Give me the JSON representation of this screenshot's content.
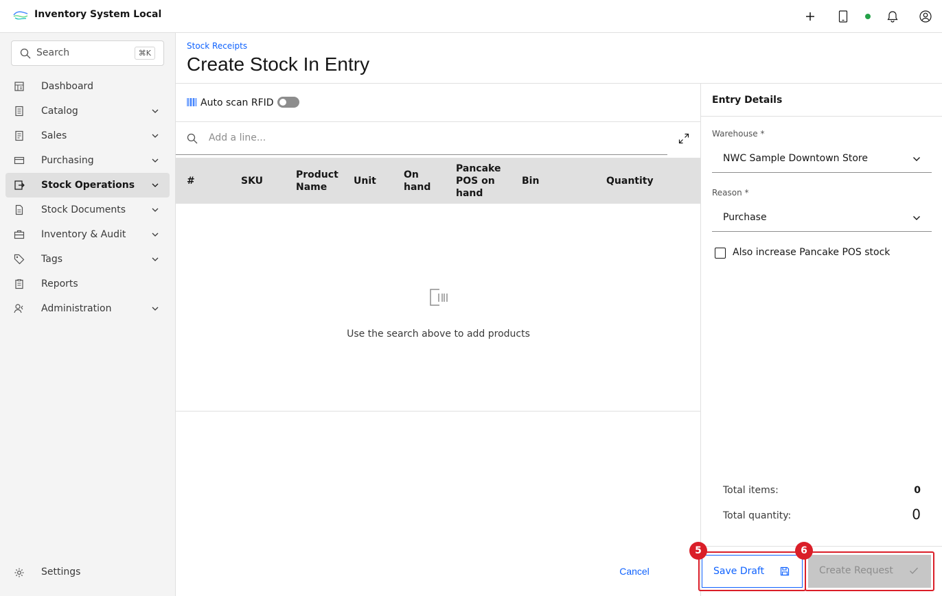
{
  "app": {
    "title": "Inventory System Local",
    "logo_icon": "brand-logo"
  },
  "header": {
    "icons": [
      "add-icon",
      "tablet-icon",
      "status-online-dot",
      "notification-icon",
      "user-avatar-icon"
    ],
    "status_color": "#24a148"
  },
  "sidebar": {
    "search": {
      "placeholder": "Search",
      "shortcut": "⌘K"
    },
    "items": [
      {
        "label": "Dashboard",
        "icon": "dashboard-icon",
        "expandable": false,
        "active": false
      },
      {
        "label": "Catalog",
        "icon": "catalog-icon",
        "expandable": true,
        "active": false
      },
      {
        "label": "Sales",
        "icon": "sales-icon",
        "expandable": true,
        "active": false
      },
      {
        "label": "Purchasing",
        "icon": "credit-card-icon",
        "expandable": true,
        "active": false
      },
      {
        "label": "Stock Operations",
        "icon": "stock-ops-icon",
        "expandable": true,
        "active": true
      },
      {
        "label": "Stock Documents",
        "icon": "document-icon",
        "expandable": true,
        "active": false
      },
      {
        "label": "Inventory & Audit",
        "icon": "inventory-icon",
        "expandable": true,
        "active": false
      },
      {
        "label": "Tags",
        "icon": "tag-icon",
        "expandable": true,
        "active": false
      },
      {
        "label": "Reports",
        "icon": "report-icon",
        "expandable": false,
        "active": false
      },
      {
        "label": "Administration",
        "icon": "user-admin-icon",
        "expandable": true,
        "active": false
      }
    ],
    "settings_label": "Settings"
  },
  "page": {
    "breadcrumb": "Stock Receipts",
    "title": "Create Stock In Entry"
  },
  "lines": {
    "rfid_label": "Auto scan RFID",
    "rfid_enabled": false,
    "add_line_placeholder": "Add a line...",
    "columns": {
      "num": "#",
      "sku": "SKU",
      "product_name_1": "Product",
      "product_name_2": "Name",
      "unit": "Unit",
      "on_hand_1": "On",
      "on_hand_2": "hand",
      "pos_1": "Pancake",
      "pos_2": "POS on",
      "pos_3": "hand",
      "bin": "Bin",
      "quantity": "Quantity"
    },
    "rows": [],
    "empty_text": "Use the search above to add products"
  },
  "entry_details": {
    "title": "Entry Details",
    "warehouse_label": "Warehouse *",
    "warehouse_value": "NWC Sample Downtown Store",
    "reason_label": "Reason *",
    "reason_value": "Purchase",
    "pos_checkbox_label": "Also increase Pancake POS stock",
    "pos_checkbox_checked": false,
    "total_items_label": "Total items:",
    "total_items_value": "0",
    "total_quantity_label": "Total quantity:",
    "total_quantity_value": "0"
  },
  "actions": {
    "cancel_label": "Cancel",
    "save_draft_label": "Save Draft",
    "create_request_label": "Create Request",
    "save_badge": "5",
    "create_badge": "6"
  },
  "colors": {
    "accent": "#0f62fe",
    "highlight": "#da1e28",
    "disabled": "#c6c6c6"
  }
}
